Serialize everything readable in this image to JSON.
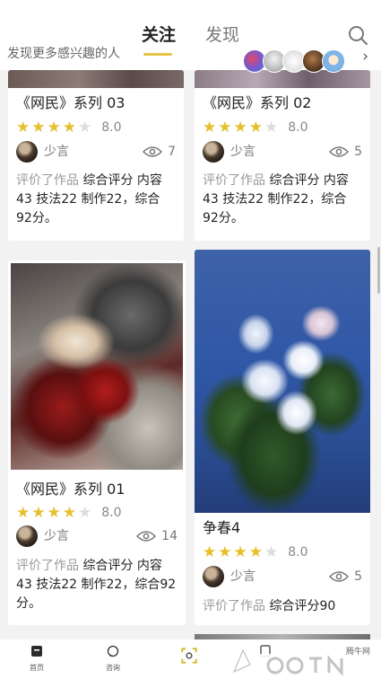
{
  "header": {
    "tabs": [
      {
        "label": "关注",
        "active": true
      },
      {
        "label": "发现",
        "active": false
      }
    ],
    "subline": "发现更多感兴趣的人",
    "search_icon": "search-icon",
    "accent_color": "#e9c34a"
  },
  "cards": [
    {
      "title": "《网民》系列 03",
      "stars_filled": 4,
      "stars_total": 5,
      "score": "8.0",
      "author": "少言",
      "views": "7",
      "review_prefix": "评价了作品",
      "review_text": "综合评分 内容43 技法22 制作22，综合92分。"
    },
    {
      "title": "《网民》系列 02",
      "stars_filled": 4,
      "stars_total": 5,
      "score": "8.0",
      "author": "少言",
      "views": "5",
      "review_prefix": "评价了作品",
      "review_text": "综合评分 内容43 技法22 制作22，综合92分。"
    },
    {
      "title": "《网民》系列 01",
      "stars_filled": 4,
      "stars_total": 5,
      "score": "8.0",
      "author": "少言",
      "views": "14",
      "review_prefix": "评价了作品",
      "review_text": "综合评分 内容43 技法22 制作22，综合92分。"
    },
    {
      "title": "争春4",
      "stars_filled": 4,
      "stars_total": 5,
      "score": "8.0",
      "author": "少言",
      "views": "5",
      "review_prefix": "评价了作品",
      "review_text": "综合评分90"
    }
  ],
  "bottom_nav": [
    {
      "label": "首页",
      "icon": "home-icon"
    },
    {
      "label": "咨询",
      "icon": "chat-icon"
    },
    {
      "label": "",
      "icon": "scan-icon"
    },
    {
      "label": "",
      "icon": "publish-icon"
    }
  ],
  "watermark": {
    "cn": "腾牛网"
  }
}
